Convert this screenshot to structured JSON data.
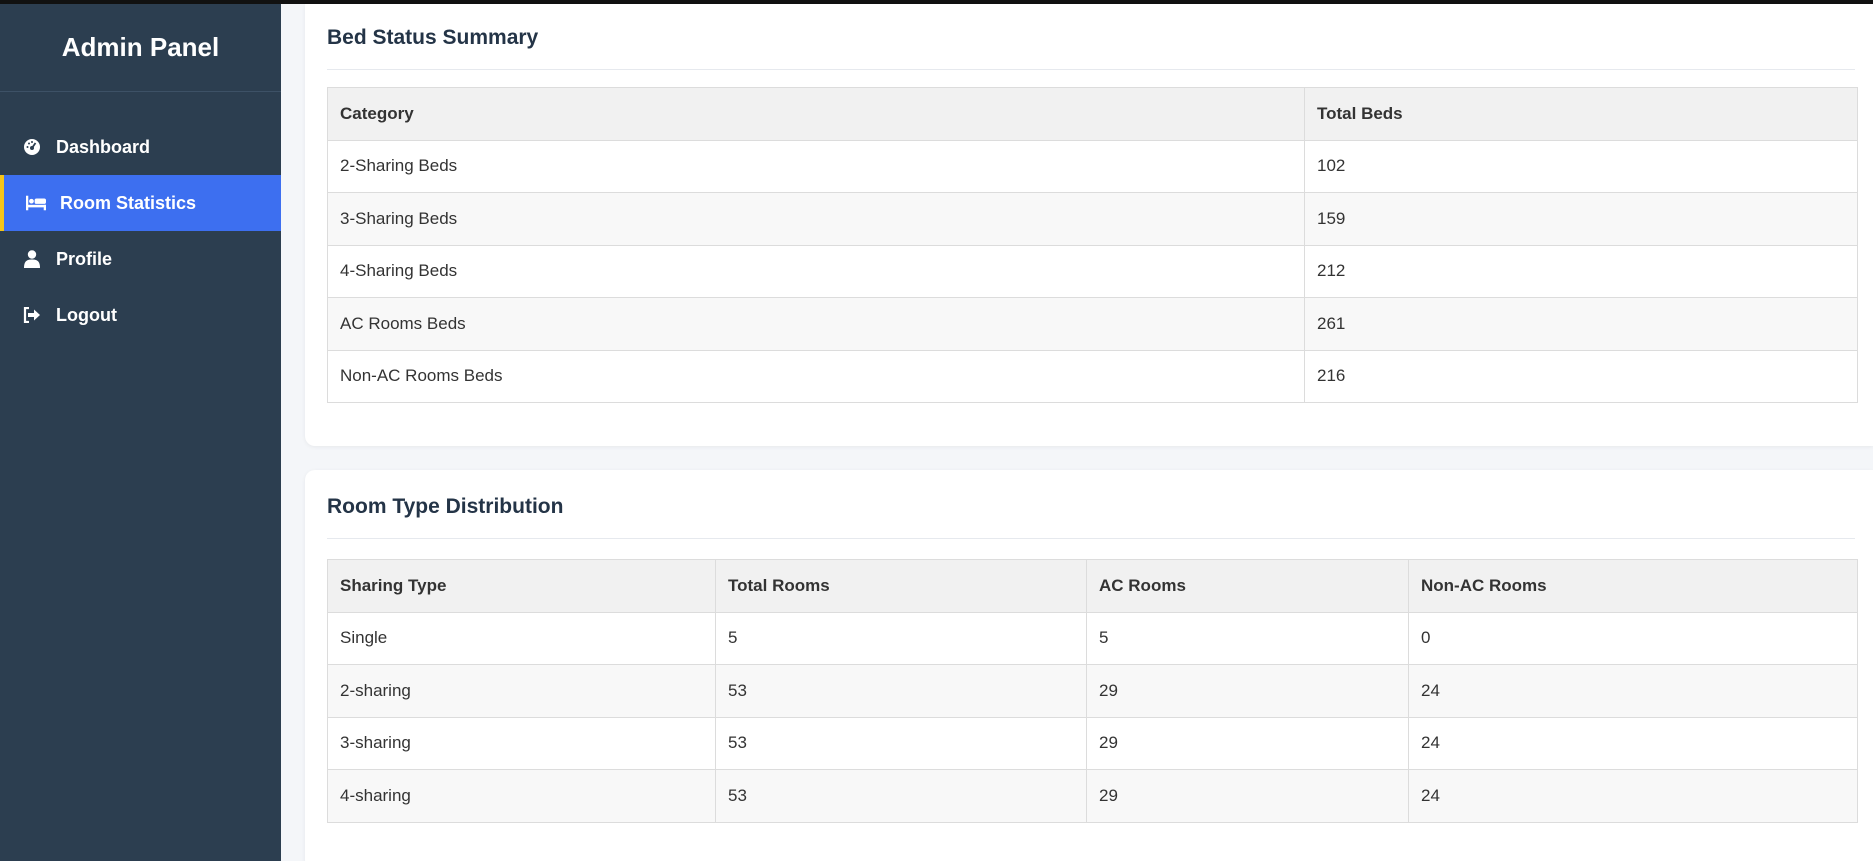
{
  "sidebar": {
    "title": "Admin Panel",
    "items": [
      {
        "label": "Dashboard",
        "icon": "dashboard-gauge-icon",
        "active": false
      },
      {
        "label": "Room Statistics",
        "icon": "bed-icon",
        "active": true
      },
      {
        "label": "Profile",
        "icon": "user-icon",
        "active": false
      },
      {
        "label": "Logout",
        "icon": "logout-icon",
        "active": false
      }
    ]
  },
  "bed_summary": {
    "title": "Bed Status Summary",
    "headers": [
      "Category",
      "Total Beds"
    ],
    "rows": [
      [
        "2-Sharing Beds",
        "102"
      ],
      [
        "3-Sharing Beds",
        "159"
      ],
      [
        "4-Sharing Beds",
        "212"
      ],
      [
        "AC Rooms Beds",
        "261"
      ],
      [
        "Non-AC Rooms Beds",
        "216"
      ]
    ]
  },
  "room_distribution": {
    "title": "Room Type Distribution",
    "headers": [
      "Sharing Type",
      "Total Rooms",
      "AC Rooms",
      "Non-AC Rooms"
    ],
    "rows": [
      [
        "Single",
        "5",
        "5",
        "0"
      ],
      [
        "2-sharing",
        "53",
        "29",
        "24"
      ],
      [
        "3-sharing",
        "53",
        "29",
        "24"
      ],
      [
        "4-sharing",
        "53",
        "29",
        "24"
      ]
    ]
  },
  "colors": {
    "sidebar_bg": "#2c3e50",
    "active_bg": "#3d6ff0",
    "active_accent": "#f5c518",
    "title_color": "#243447"
  }
}
